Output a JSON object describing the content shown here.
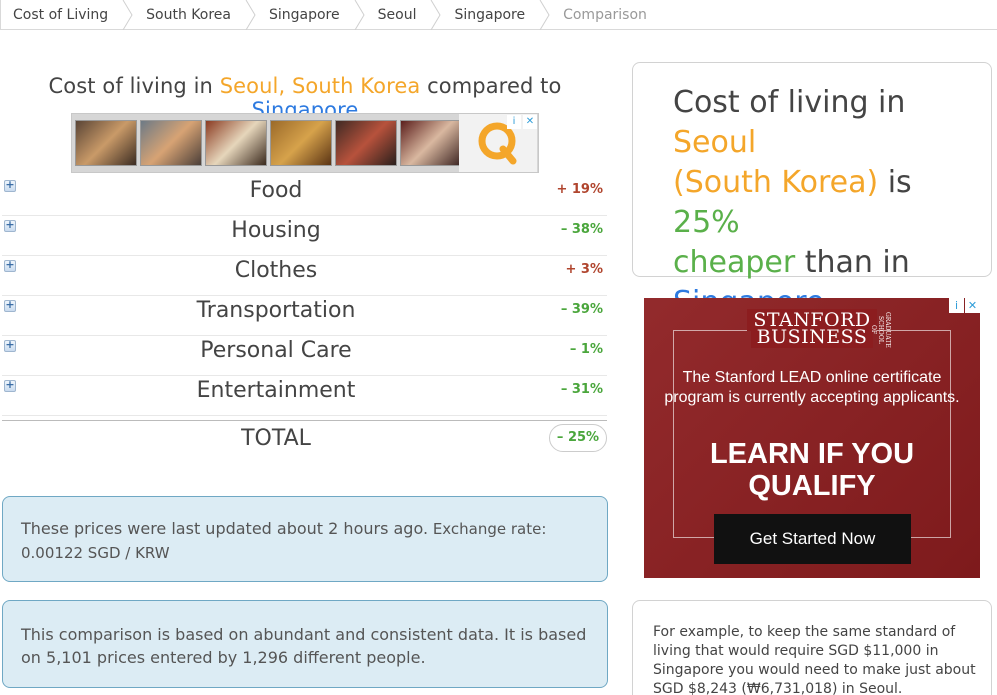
{
  "breadcrumb": [
    {
      "label": "Cost of Living",
      "current": false
    },
    {
      "label": "South Korea",
      "current": false
    },
    {
      "label": "Singapore",
      "current": false
    },
    {
      "label": "Seoul",
      "current": false
    },
    {
      "label": "Singapore",
      "current": false
    },
    {
      "label": "Comparison",
      "current": true
    }
  ],
  "heading": {
    "prefix": "Cost of living in ",
    "city": "Seoul, South Korea",
    "middle": " compared to ",
    "target": "Singapore"
  },
  "top_ad": {
    "logo_letter": "Q",
    "choice_info": "i",
    "choice_close": "✕"
  },
  "categories": [
    {
      "label": "Food",
      "delta": "+ 19%",
      "direction": "up"
    },
    {
      "label": "Housing",
      "delta": "– 38%",
      "direction": "down"
    },
    {
      "label": "Clothes",
      "delta": "+ 3%",
      "direction": "up"
    },
    {
      "label": "Transportation",
      "delta": "– 39%",
      "direction": "down"
    },
    {
      "label": "Personal Care",
      "delta": "– 1%",
      "direction": "down"
    },
    {
      "label": "Entertainment",
      "delta": "– 31%",
      "direction": "down"
    }
  ],
  "total": {
    "label": "TOTAL",
    "delta": "– 25%"
  },
  "updated_info": {
    "text": "These prices were last updated about 2 hours ago.",
    "rate": " Exchange rate: 0.00122 SGD / KRW"
  },
  "data_info": {
    "text": "This comparison is based on abundant and consistent data. It is based on 5,101 prices entered by 1,296 different people."
  },
  "summary": {
    "prefix": "Cost of living in ",
    "city": "Seoul",
    "country": "(South Korea)",
    "is": " is ",
    "percent": "25%",
    "cheaper": "cheaper",
    "than": " than in ",
    "target": "Singapore"
  },
  "stanford_ad": {
    "brand_line1": "STANFORD",
    "brand_line2": "BUSINESS",
    "brand_sub": "GRADUATE SCHOOL OF",
    "body": "The Stanford LEAD online certificate program is currently accepting applicants.",
    "headline": "LEARN IF YOU QUALIFY",
    "cta": "Get Started Now",
    "choice_info": "i",
    "choice_close": "✕"
  },
  "example": {
    "text": "For example, to keep the same standard of living that would require SGD $11,000 in Singapore you would need to make just about SGD $8,243 (₩6,731,018) in Seoul."
  },
  "colors": {
    "orange": "#f4a62a",
    "blue": "#2d7ae0",
    "green": "#5ab04a",
    "red_delta": "#b0452e",
    "ad_red": "#8c1d1f",
    "info_bg": "#dcecf4"
  }
}
